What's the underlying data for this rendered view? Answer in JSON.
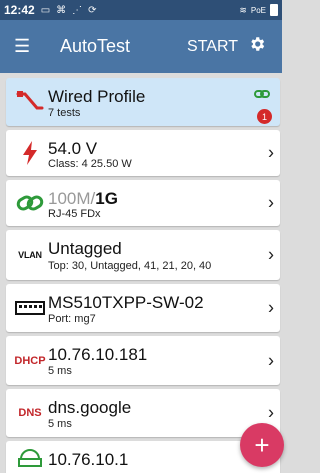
{
  "status": {
    "time": "12:42"
  },
  "appbar": {
    "title": "AutoTest",
    "start_label": "START"
  },
  "cards": [
    {
      "main": "Wired Profile",
      "sub": "7 tests",
      "badge": "1"
    },
    {
      "main": "54.0 V",
      "sub": "Class: 4   25.50 W"
    },
    {
      "main_dim": "100M/",
      "main_bold": "1G",
      "sub": "RJ-45   FDx"
    },
    {
      "tag": "VLAN",
      "main": "Untagged",
      "sub": "Top: 30, Untagged, 41, 21, 20, 40"
    },
    {
      "main": "MS510TXPP-SW-02",
      "sub": "Port: mg7"
    },
    {
      "tag": "DHCP",
      "main": "10.76.10.181",
      "sub": "5 ms"
    },
    {
      "tag": "DNS",
      "main": "dns.google",
      "sub": "5 ms"
    },
    {
      "main": "10.76.10.1"
    }
  ],
  "colors": {
    "appbar": "#4a75a4",
    "statusbar": "#2e4f76",
    "highlight_card": "#cfe6f8",
    "fab": "#d93a64",
    "accent_green": "#2e9a3a",
    "accent_red": "#d42a2a"
  },
  "icons": {
    "wired_profile": "ethernet-cable-icon",
    "poe": "lightning-bolt-icon",
    "link": "chain-link-icon",
    "switch": "switch-icon",
    "gateway": "gateway-icon",
    "fab": "plus-icon"
  }
}
